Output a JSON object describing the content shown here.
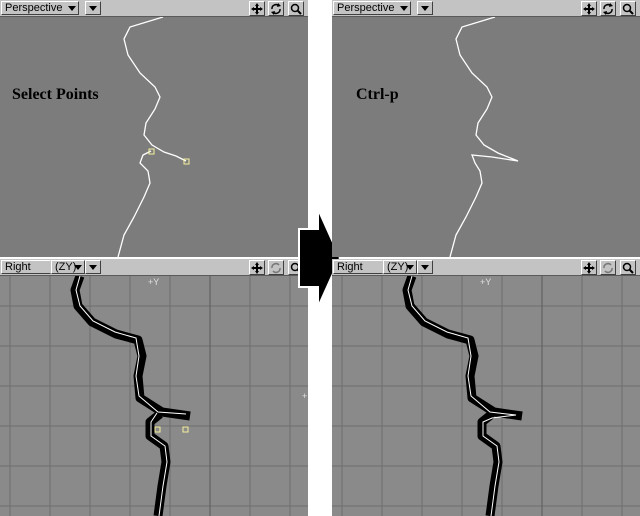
{
  "panels": {
    "left": {
      "top_view": {
        "label": "Perspective"
      },
      "bottom_view": {
        "label": "Right",
        "axis_selector": "(ZY)"
      },
      "annotation": "Select Points",
      "axis_labels": {
        "top": "+Y",
        "side": "+"
      }
    },
    "right": {
      "top_view": {
        "label": "Perspective"
      },
      "bottom_view": {
        "label": "Right",
        "axis_selector": "(ZY)"
      },
      "annotation": "Ctrl-p",
      "axis_labels": {
        "top": "+Y",
        "side": "+"
      }
    }
  },
  "icons": {
    "dropdown": "chevron-down-icon",
    "move": "move-icon",
    "rotate": "rotate-icon",
    "zoom": "magnifier-icon",
    "arrow": "right-arrow-icon"
  },
  "colors": {
    "viewport_bg": "#7c7c7c",
    "header_bg": "#c3c3c3",
    "curve": "#ffffff",
    "selected_point": "#f6f0a0",
    "cage": "#000000"
  }
}
